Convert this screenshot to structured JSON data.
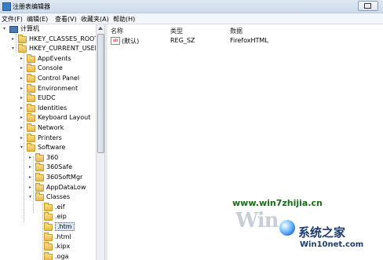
{
  "window": {
    "title": "注册表编辑器"
  },
  "menu": [
    "文件(F)",
    "编辑(E)",
    "查看(V)",
    "收藏夹(A)",
    "帮助(H)"
  ],
  "tree": [
    {
      "label": "计算机",
      "expander": "▾",
      "icon": "computer-icon"
    },
    {
      "label": "HKEY_CLASSES_ROOT",
      "expander": "▸",
      "icon": "folder-icon"
    },
    {
      "label": "HKEY_CURRENT_USER",
      "expander": "▾",
      "icon": "folder-icon"
    },
    {
      "label": "AppEvents",
      "expander": "▸",
      "icon": "folder-icon"
    },
    {
      "label": "Console",
      "expander": "▸",
      "icon": "folder-icon"
    },
    {
      "label": "Control Panel",
      "expander": "▸",
      "icon": "folder-icon"
    },
    {
      "label": "Environment",
      "expander": "▸",
      "icon": "folder-icon"
    },
    {
      "label": "EUDC",
      "expander": "▸",
      "icon": "folder-icon"
    },
    {
      "label": "Identities",
      "expander": "▸",
      "icon": "folder-icon"
    },
    {
      "label": "Keyboard Layout",
      "expander": "▸",
      "icon": "folder-icon"
    },
    {
      "label": "Network",
      "expander": "▸",
      "icon": "folder-icon"
    },
    {
      "label": "Printers",
      "expander": "▸",
      "icon": "folder-icon"
    },
    {
      "label": "Software",
      "expander": "▾",
      "icon": "folder-icon"
    },
    {
      "label": "360",
      "expander": "▸",
      "icon": "folder-icon"
    },
    {
      "label": "360Safe",
      "expander": "▸",
      "icon": "folder-icon"
    },
    {
      "label": "360SoftMgr",
      "expander": "▸",
      "icon": "folder-icon"
    },
    {
      "label": "AppDataLow",
      "expander": "▸",
      "icon": "folder-icon"
    },
    {
      "label": "Classes",
      "expander": "▾",
      "icon": "folder-icon"
    },
    {
      "label": ".eif",
      "expander": "",
      "icon": "folder-icon"
    },
    {
      "label": ".eip",
      "expander": "",
      "icon": "folder-icon"
    },
    {
      "label": ".htm",
      "expander": "",
      "icon": "folder-icon",
      "selected": true
    },
    {
      "label": ".html",
      "expander": "",
      "icon": "folder-icon"
    },
    {
      "label": ".kipx",
      "expander": "",
      "icon": "folder-icon"
    },
    {
      "label": ".oga",
      "expander": "",
      "icon": "folder-icon"
    }
  ],
  "list": {
    "columns": [
      "名称",
      "类型",
      "数据"
    ],
    "rows": [
      {
        "icon": "ab",
        "name": "(默认)",
        "type": "REG_SZ",
        "data": "FirefoxHTML"
      }
    ]
  },
  "watermark": {
    "url": "www.win7zhijia.cn",
    "logo": "Win",
    "site_name": "系统之家",
    "site_url": "Win10net.com"
  }
}
